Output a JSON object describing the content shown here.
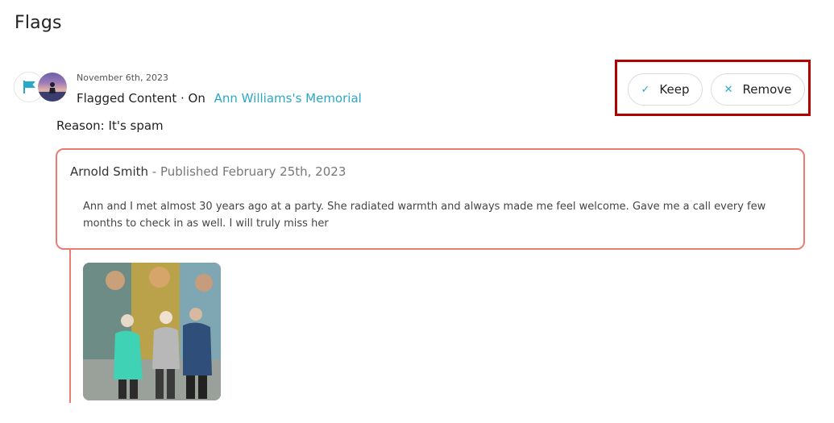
{
  "page": {
    "title": "Flags"
  },
  "flag": {
    "date": "November 6th, 2023",
    "type_label": "Flagged Content · On",
    "memorial_link": "Ann Williams's Memorial",
    "reason_label": "Reason:",
    "reason_value": "It's spam"
  },
  "actions": {
    "keep_label": "Keep",
    "keep_icon": "check-icon",
    "remove_label": "Remove",
    "remove_icon": "x-icon"
  },
  "post": {
    "author": "Arnold Smith",
    "separator": " - ",
    "published": "Published February 25th, 2023",
    "body": "Ann and I met almost 30 years ago at a party. She radiated warmth and always made me feel welcome. Gave me a call every few months to check in as well. I will truly miss her"
  },
  "colors": {
    "accent": "#2aa8c7",
    "card_border": "#ec7b76",
    "highlight_box": "#b00000"
  }
}
